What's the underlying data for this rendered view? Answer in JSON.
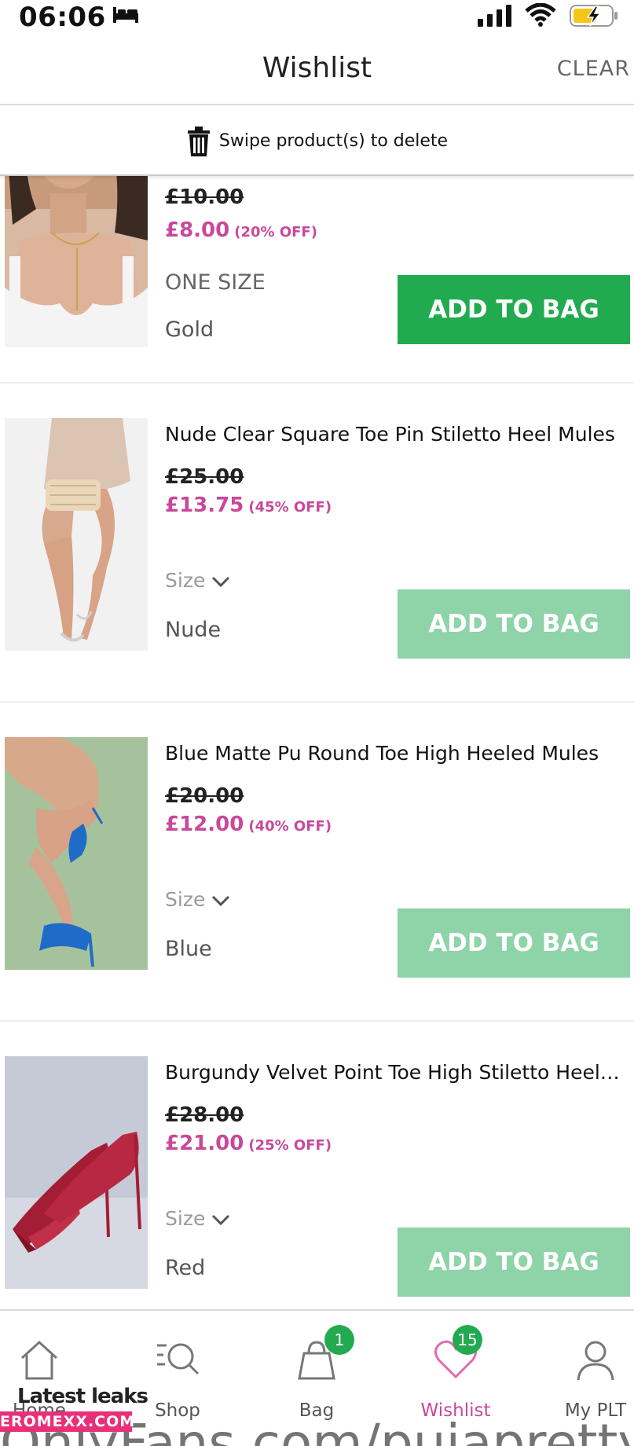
{
  "status_bar": {
    "time": "06:06"
  },
  "header": {
    "title": "Wishlist",
    "clear_label": "CLEAR"
  },
  "swipe_hint": {
    "text": "Swipe product(s) to delete"
  },
  "products": [
    {
      "name": "",
      "old_price": "£10.00",
      "new_price": "£8.00",
      "discount": "(20% OFF)",
      "size": "ONE SIZE",
      "colour": "Gold",
      "button": "ADD TO BAG",
      "button_state": "active"
    },
    {
      "name": "Nude Clear Square Toe Pin Stiletto Heel Mules",
      "old_price": "£25.00",
      "new_price": "£13.75",
      "discount": "(45% OFF)",
      "size": "Size",
      "colour": "Nude",
      "button": "ADD TO BAG",
      "button_state": "disabled"
    },
    {
      "name": "Blue Matte Pu Round Toe High Heeled Mules",
      "old_price": "£20.00",
      "new_price": "£12.00",
      "discount": "(40% OFF)",
      "size": "Size",
      "colour": "Blue",
      "button": "ADD TO BAG",
      "button_state": "disabled"
    },
    {
      "name": "Burgundy Velvet Point Toe High Stiletto Heeled M...",
      "old_price": "£28.00",
      "new_price": "£21.00",
      "discount": "(25% OFF)",
      "size": "Size",
      "colour": "Red",
      "button": "ADD TO BAG",
      "button_state": "disabled"
    }
  ],
  "tab_bar": {
    "tabs": [
      {
        "label": "Home",
        "icon": "home-icon"
      },
      {
        "label": "Shop",
        "icon": "search-icon"
      },
      {
        "label": "Bag",
        "icon": "bag-icon",
        "badge": "1"
      },
      {
        "label": "Wishlist",
        "icon": "heart-icon",
        "badge": "15"
      },
      {
        "label": "My PLT",
        "icon": "user-icon"
      }
    ]
  },
  "watermark": {
    "leaks": "Latest leaks",
    "site": "EROMEXX.COM",
    "onlyfans": "OnlyFans.com/pujapretty"
  },
  "colors": {
    "accent_pink": "#c9489a",
    "brand_green": "#22aa50",
    "disabled_green": "#8fd3a8"
  }
}
